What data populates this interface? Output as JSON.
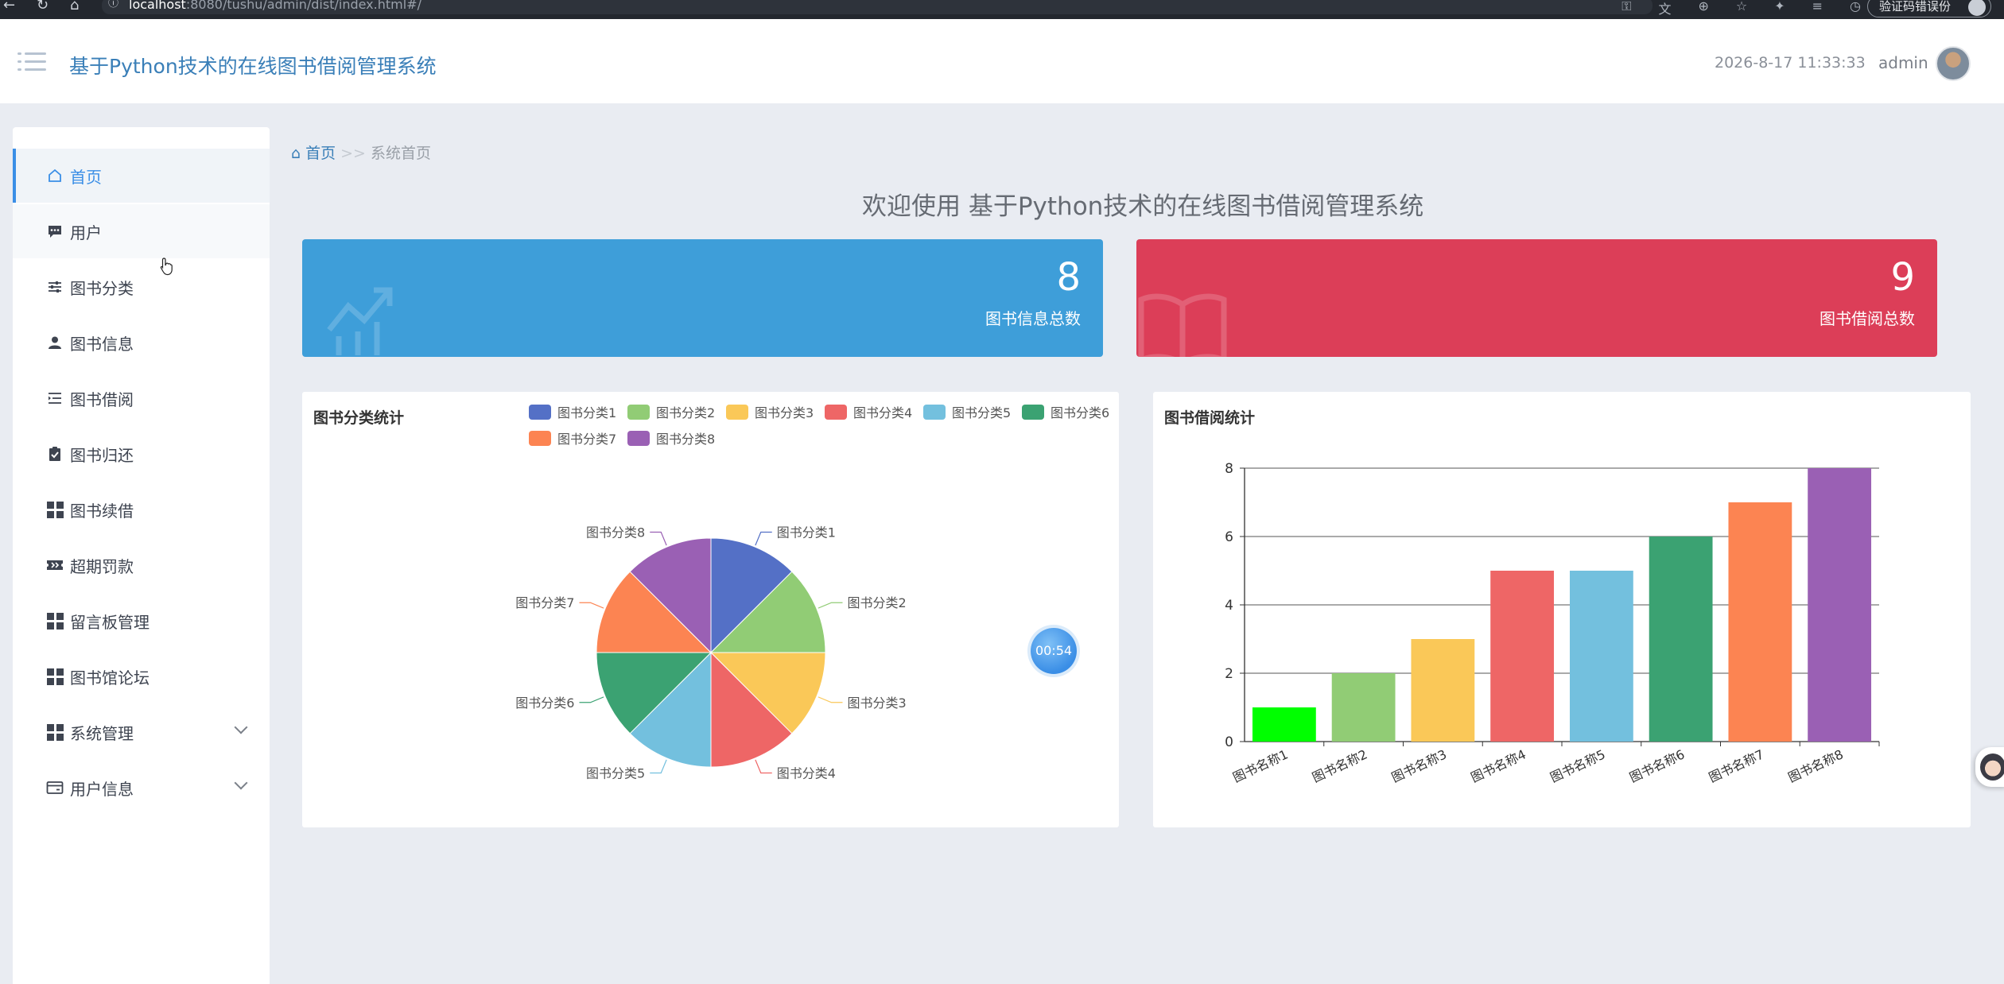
{
  "browser": {
    "url_host": "localhost",
    "url_rest": ":8080/tushu/admin/dist/index.html#/",
    "sync_label": "验证码错误份"
  },
  "header": {
    "title": "基于Python技术的在线图书借阅管理系统",
    "datetime": "2026-8-17 11:33:33",
    "username": "admin"
  },
  "sidebar": {
    "items": [
      {
        "label": "首页",
        "icon": "home-icon",
        "active": true
      },
      {
        "label": "用户",
        "icon": "chat-icon"
      },
      {
        "label": "图书分类",
        "icon": "sliders-icon"
      },
      {
        "label": "图书信息",
        "icon": "user-icon"
      },
      {
        "label": "图书借阅",
        "icon": "list-icon"
      },
      {
        "label": "图书归还",
        "icon": "clipboard-check-icon"
      },
      {
        "label": "图书续借",
        "icon": "grid-icon"
      },
      {
        "label": "超期罚款",
        "icon": "ticket-icon"
      },
      {
        "label": "留言板管理",
        "icon": "grid-icon"
      },
      {
        "label": "图书馆论坛",
        "icon": "grid-icon"
      },
      {
        "label": "系统管理",
        "icon": "grid-icon",
        "expandable": true
      },
      {
        "label": "用户信息",
        "icon": "card-icon",
        "expandable": true
      }
    ]
  },
  "breadcrumb": {
    "home": "首页",
    "separator": ">>",
    "current": "系统首页"
  },
  "welcome": "欢迎使用 基于Python技术的在线图书借阅管理系统",
  "stats": [
    {
      "value": "8",
      "label": "图书信息总数",
      "color": "#3e9ed9",
      "icon": "chart-trend-icon"
    },
    {
      "value": "9",
      "label": "图书借阅总数",
      "color": "#dc3e58",
      "icon": "book-icon"
    }
  ],
  "timer": "00:54",
  "pie_panel": {
    "title": "图书分类统计"
  },
  "bar_panel": {
    "title": "图书借阅统计"
  },
  "chart_data": [
    {
      "type": "pie",
      "title": "图书分类统计",
      "categories": [
        "图书分类1",
        "图书分类2",
        "图书分类3",
        "图书分类4",
        "图书分类5",
        "图书分类6",
        "图书分类7",
        "图书分类8"
      ],
      "values": [
        1,
        1,
        1,
        1,
        1,
        1,
        1,
        1
      ],
      "colors": [
        "#5470c6",
        "#91cc75",
        "#fac858",
        "#ee6666",
        "#73c0de",
        "#3ba272",
        "#fc8452",
        "#9a60b4"
      ],
      "legend": "top"
    },
    {
      "type": "bar",
      "title": "图书借阅统计",
      "categories": [
        "图书名称1",
        "图书名称2",
        "图书名称3",
        "图书名称4",
        "图书名称5",
        "图书名称6",
        "图书名称7",
        "图书名称8"
      ],
      "values": [
        1,
        2,
        3,
        5,
        5,
        6,
        7,
        8
      ],
      "colors": [
        "#00ff00",
        "#91cc75",
        "#fac858",
        "#ee6666",
        "#73c0de",
        "#3ba272",
        "#fc8452",
        "#9a60b4"
      ],
      "ylim": [
        0,
        8
      ],
      "yticks": [
        0,
        2,
        4,
        6,
        8
      ],
      "grid": true
    }
  ]
}
